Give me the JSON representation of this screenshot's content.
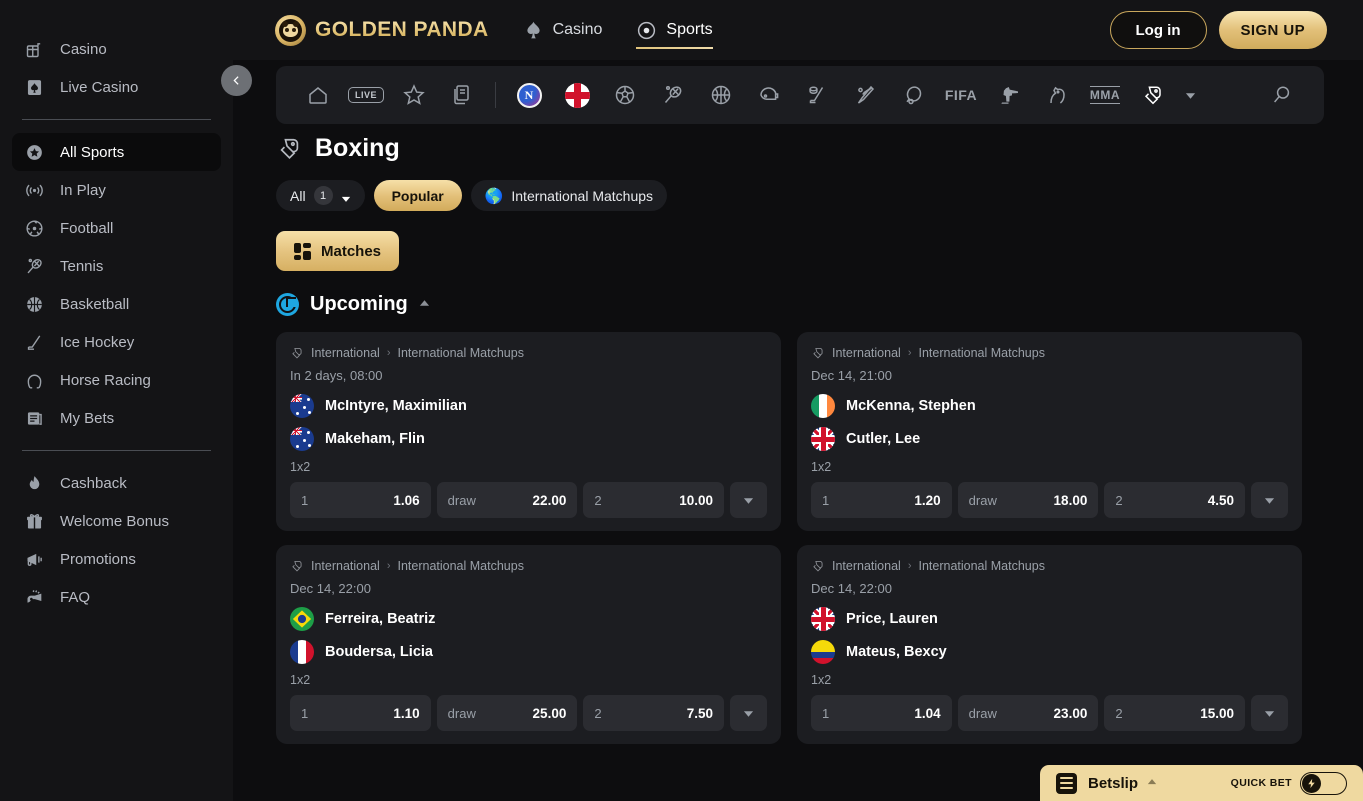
{
  "sidebar": {
    "groups": [
      {
        "items": [
          {
            "label": "Casino",
            "icon": "slot-machine-icon",
            "active": false
          },
          {
            "label": "Live Casino",
            "icon": "spade-card-icon",
            "active": false
          }
        ]
      },
      {
        "items": [
          {
            "label": "All Sports",
            "icon": "all-sports-star-icon",
            "active": true
          },
          {
            "label": "In Play",
            "icon": "in-play-broadcast-icon",
            "active": false
          },
          {
            "label": "Football",
            "icon": "football-icon",
            "active": false
          },
          {
            "label": "Tennis",
            "icon": "tennis-racket-icon",
            "active": false
          },
          {
            "label": "Basketball",
            "icon": "basketball-icon",
            "active": false
          },
          {
            "label": "Ice Hockey",
            "icon": "ice-hockey-stick-icon",
            "active": false
          },
          {
            "label": "Horse Racing",
            "icon": "horseshoe-icon",
            "active": false
          },
          {
            "label": "My Bets",
            "icon": "my-bets-ticket-icon",
            "active": false
          }
        ]
      },
      {
        "items": [
          {
            "label": "Cashback",
            "icon": "flame-icon",
            "active": false
          },
          {
            "label": "Welcome Bonus",
            "icon": "gift-icon",
            "active": false
          },
          {
            "label": "Promotions",
            "icon": "megaphone-icon",
            "active": false
          },
          {
            "label": "FAQ",
            "icon": "whistle-icon",
            "active": false
          }
        ]
      }
    ]
  },
  "header": {
    "brand": "GOLDEN PANDA",
    "nav": [
      {
        "label": "Casino",
        "icon": "spade-icon",
        "active": false
      },
      {
        "label": "Sports",
        "icon": "sports-ball-icon",
        "active": true
      }
    ],
    "login_label": "Log in",
    "signup_label": "SIGN UP"
  },
  "sportsbar": {
    "items": [
      {
        "name": "home-icon",
        "kind": "icon"
      },
      {
        "name": "live-badge",
        "kind": "text",
        "label": "LIVE"
      },
      {
        "name": "favorites-star-icon",
        "kind": "icon"
      },
      {
        "name": "bet-history-icon",
        "kind": "icon"
      },
      {
        "name": "divider",
        "kind": "divider"
      },
      {
        "name": "nba-logo-icon",
        "kind": "logo"
      },
      {
        "name": "england-flag-icon",
        "kind": "flag"
      },
      {
        "name": "soccer-icon",
        "kind": "icon"
      },
      {
        "name": "tennis-icon",
        "kind": "icon"
      },
      {
        "name": "basketball-icon",
        "kind": "icon"
      },
      {
        "name": "american-football-icon",
        "kind": "icon"
      },
      {
        "name": "ice-hockey-icon",
        "kind": "icon"
      },
      {
        "name": "baseball-icon",
        "kind": "icon"
      },
      {
        "name": "table-tennis-icon",
        "kind": "icon"
      },
      {
        "name": "fifa-icon",
        "kind": "text",
        "label": "FIFA"
      },
      {
        "name": "shooting-icon",
        "kind": "icon"
      },
      {
        "name": "horse-racing-icon",
        "kind": "icon"
      },
      {
        "name": "mma-icon",
        "kind": "text",
        "label": "MMA"
      },
      {
        "name": "boxing-glove-icon",
        "kind": "icon",
        "selected": true
      }
    ],
    "search_icon": "search-icon"
  },
  "main": {
    "page_title": "Boxing",
    "page_icon": "boxing-glove-icon",
    "filters": [
      {
        "label": "All",
        "badge": "1",
        "style": "dark",
        "caret": true
      },
      {
        "label": "Popular",
        "style": "gold"
      },
      {
        "label": "International Matchups",
        "style": "dark",
        "emoji": "globe"
      }
    ],
    "tabs": [
      {
        "label": "Matches",
        "active": true
      }
    ],
    "section": {
      "label": "Upcoming",
      "expanded": true
    },
    "odds_labels": {
      "home": "1",
      "draw": "draw",
      "away": "2"
    },
    "market_name": "1x2",
    "cards": [
      {
        "league_region": "International",
        "league_name": "International Matchups",
        "time": "In 2 days, 08:00",
        "market": "1x2",
        "teams": [
          {
            "name": "McIntyre, Maximilian",
            "flag": "au"
          },
          {
            "name": "Makeham, Flin",
            "flag": "au"
          }
        ],
        "odds": [
          {
            "label": "1",
            "value": "1.06"
          },
          {
            "label": "draw",
            "value": "22.00"
          },
          {
            "label": "2",
            "value": "10.00"
          }
        ]
      },
      {
        "league_region": "International",
        "league_name": "International Matchups",
        "time": "Dec 14, 21:00",
        "market": "1x2",
        "teams": [
          {
            "name": "McKenna, Stephen",
            "flag": "ie"
          },
          {
            "name": "Cutler, Lee",
            "flag": "gb"
          }
        ],
        "odds": [
          {
            "label": "1",
            "value": "1.20"
          },
          {
            "label": "draw",
            "value": "18.00"
          },
          {
            "label": "2",
            "value": "4.50"
          }
        ]
      },
      {
        "league_region": "International",
        "league_name": "International Matchups",
        "time": "Dec 14, 22:00",
        "market": "1x2",
        "teams": [
          {
            "name": "Ferreira, Beatriz",
            "flag": "br"
          },
          {
            "name": "Boudersa, Licia",
            "flag": "fr"
          }
        ],
        "odds": [
          {
            "label": "1",
            "value": "1.10"
          },
          {
            "label": "draw",
            "value": "25.00"
          },
          {
            "label": "2",
            "value": "7.50"
          }
        ]
      },
      {
        "league_region": "International",
        "league_name": "International Matchups",
        "time": "Dec 14, 22:00",
        "market": "1x2",
        "teams": [
          {
            "name": "Price, Lauren",
            "flag": "gb"
          },
          {
            "name": "Mateus, Bexcy",
            "flag": "co"
          }
        ],
        "odds": [
          {
            "label": "1",
            "value": "1.04"
          },
          {
            "label": "draw",
            "value": "23.00"
          },
          {
            "label": "2",
            "value": "15.00"
          }
        ]
      }
    ]
  },
  "betslip": {
    "label": "Betslip",
    "quick_bet_label": "QUICK BET",
    "quick_bet_on": false
  },
  "colors": {
    "page_bg": "#0d0d0f",
    "panel_bg": "#1c1d21",
    "gold": "#e3c079",
    "betslip_bg": "#efd9a0",
    "accent_blue": "#1ea7e1"
  }
}
